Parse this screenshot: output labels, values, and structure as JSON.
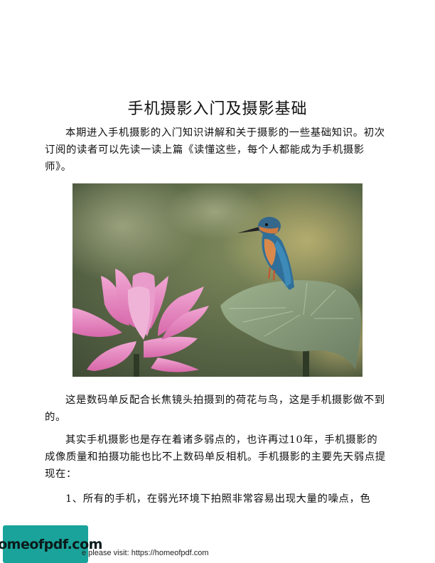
{
  "document": {
    "title": "手机摄影入门及摄影基础",
    "paragraphs": {
      "intro": "本期进入手机摄影的入门知识讲解和关于摄影的一些基础知识。初次订阅的读者可以先读一读上篇《读懂这些，每个人都能成为手机摄影师》。",
      "caption": "这是数码单反配合长焦镜头拍摄到的荷花与鸟，这是手机摄影做不到的。",
      "weakness": "其实手机摄影也是存在着诸多弱点的，也许再过10年，手机摄影的成像质量和拍摄功能也比不上数码单反相机。手机摄影的主要先天弱点提现在：",
      "item1": "1、所有的手机，在弱光环境下拍照非常容易出现大量的噪点，色"
    }
  },
  "watermark": {
    "logo_text": "homeofpdf.com",
    "footer_text": "e please visit: https://homeofpdf.com",
    "logo_color": "#1aa39a"
  }
}
